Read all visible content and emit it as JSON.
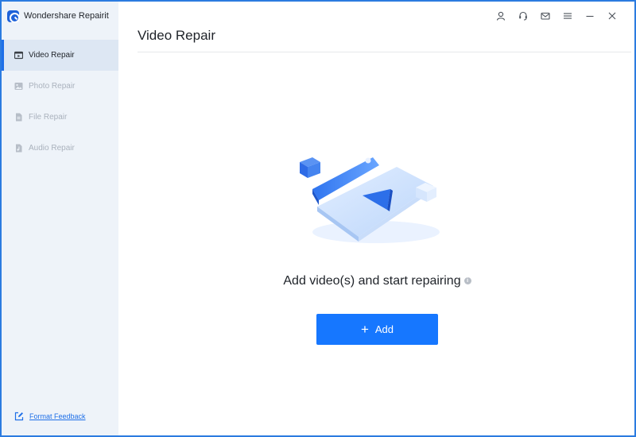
{
  "app": {
    "title": "Wondershare Repairit"
  },
  "sidebar": {
    "items": [
      {
        "label": "Video Repair",
        "icon": "video-icon",
        "active": true
      },
      {
        "label": "Photo Repair",
        "icon": "photo-icon",
        "active": false
      },
      {
        "label": "File Repair",
        "icon": "file-icon",
        "active": false
      },
      {
        "label": "Audio Repair",
        "icon": "audio-icon",
        "active": false
      }
    ],
    "feedback_label": "Format Feedback"
  },
  "titlebar": {
    "icons": [
      "user-icon",
      "headset-icon",
      "mail-icon",
      "menu-icon",
      "minimize-icon",
      "close-icon"
    ]
  },
  "main": {
    "title": "Video Repair",
    "headline": "Add video(s) and start repairing",
    "info_glyph": "i",
    "add_button": {
      "plus": "+",
      "label": "Add"
    }
  },
  "colors": {
    "accent": "#1677ff",
    "sidebar_bg": "#eef3f9",
    "active_bg": "#dde7f3",
    "inactive_text": "#aab2bd",
    "window_border": "#2b7be0"
  }
}
